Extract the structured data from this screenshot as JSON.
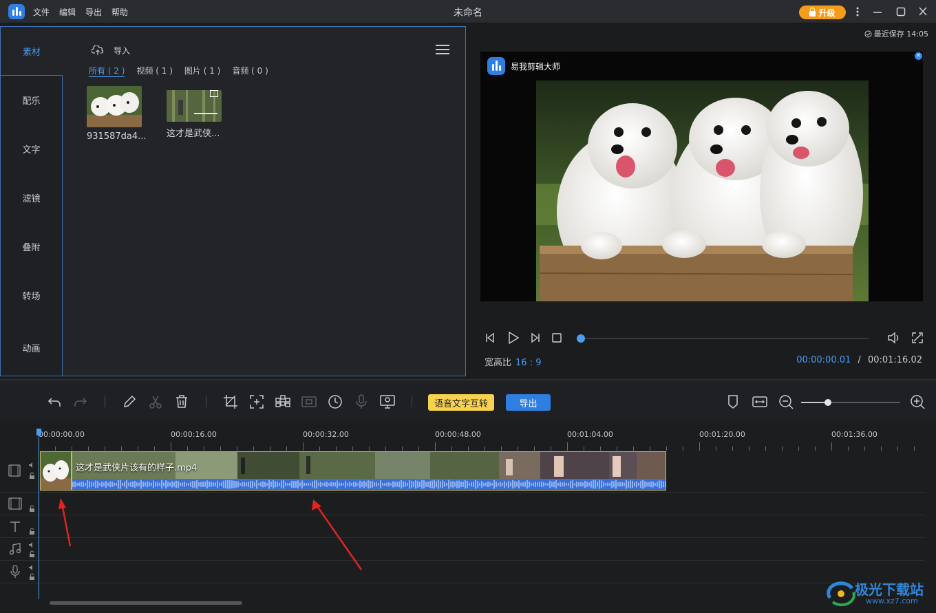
{
  "titlebar": {
    "title": "未命名",
    "menu": [
      "文件",
      "编辑",
      "导出",
      "帮助"
    ],
    "upgrade_label": "升级",
    "icons": [
      "app-logo",
      "more-icon",
      "minimize-icon",
      "maximize-icon",
      "close-icon"
    ]
  },
  "sidebar": {
    "tabs": [
      {
        "label": "素材",
        "active": true
      },
      {
        "label": "配乐"
      },
      {
        "label": "文字"
      },
      {
        "label": "滤镜"
      },
      {
        "label": "叠附"
      },
      {
        "label": "转场"
      },
      {
        "label": "动画"
      }
    ]
  },
  "media": {
    "import_label": "导入",
    "filters": [
      {
        "label": "所有 ( 2 )",
        "active": true
      },
      {
        "label": "视频 ( 1 )"
      },
      {
        "label": "图片 ( 1 )"
      },
      {
        "label": "音频 ( 0 )"
      }
    ],
    "items": [
      {
        "name": "931587da4...",
        "kind": "image"
      },
      {
        "name": "这才是武侠...",
        "kind": "video"
      }
    ]
  },
  "preview": {
    "last_saved": "最近保存 14:05",
    "watermark_text": "易我剪辑大师",
    "aspect_label": "宽高比",
    "aspect_value": "16 : 9",
    "current_time": "00:00:00.01",
    "separator": "/",
    "total_time": "00:01:16.02",
    "progress": 0.0
  },
  "toolbar": {
    "speech_button": "语音文字互转",
    "export_button": "导出",
    "zoom_level": 0.27
  },
  "timeline": {
    "ruler": [
      "00:00:00.00",
      "00:00:16.00",
      "00:00:32.00",
      "00:00:48.00",
      "00:01:04.00",
      "00:01:20.00",
      "00:01:36.00"
    ],
    "clip_title": "这才是武侠片该有的样子.mp4",
    "tracks": [
      "video-track",
      "overlay-track",
      "text-track",
      "music-track",
      "voice-track"
    ]
  },
  "watermark": {
    "site_name": "极光下载站",
    "site_url": "www.xz7.com"
  },
  "colors": {
    "accent": "#4b9cf4",
    "upgrade": "#f59d1b",
    "speech_button": "#f9d24d",
    "export_button": "#2f7fe3",
    "clip_border": "#c9b96a",
    "waveform": "#3c6fd6"
  }
}
